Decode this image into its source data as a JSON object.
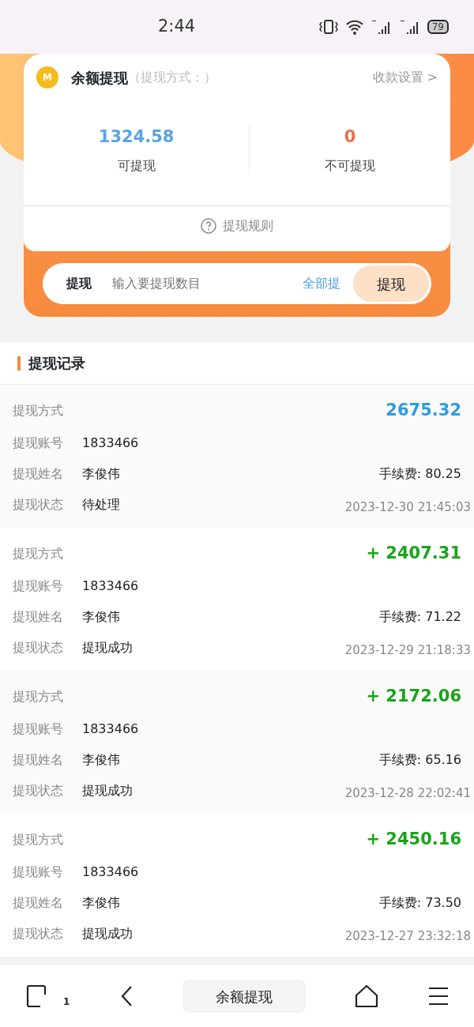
{
  "status_bar": {
    "time": "2:44",
    "battery": "79"
  },
  "balance_card": {
    "coin_letter": "M",
    "title": "余额提现",
    "subtitle": "（提现方式：）",
    "settings_link": "收款设置 >",
    "available": {
      "amount": "1324.58",
      "label": "可提现"
    },
    "unavailable": {
      "amount": "0",
      "label": "不可提现"
    },
    "rules_link": "提现规则"
  },
  "withdraw_bar": {
    "label": "提现",
    "placeholder": "输入要提现数目",
    "all_link": "全部提",
    "submit": "提现"
  },
  "records_title": "提现记录",
  "records": [
    {
      "kind": "pending",
      "method_label": "提现方式",
      "account_label": "提现账号",
      "account": "1833466",
      "name_label": "提现姓名",
      "name": "李俊伟",
      "status_label": "提现状态",
      "status": "待处理",
      "amount": "2675.32",
      "fee": "手续费: 80.25",
      "time": "2023-12-30 21:45:03"
    },
    {
      "kind": "success",
      "method_label": "提现方式",
      "account_label": "提现账号",
      "account": "1833466",
      "name_label": "提现姓名",
      "name": "李俊伟",
      "status_label": "提现状态",
      "status": "提现成功",
      "amount": "+ 2407.31",
      "fee": "手续费: 71.22",
      "time": "2023-12-29 21:18:33"
    },
    {
      "kind": "success",
      "method_label": "提现方式",
      "account_label": "提现账号",
      "account": "1833466",
      "name_label": "提现姓名",
      "name": "李俊伟",
      "status_label": "提现状态",
      "status": "提现成功",
      "amount": "+ 2172.06",
      "fee": "手续费: 65.16",
      "time": "2023-12-28 22:02:41"
    },
    {
      "kind": "success",
      "method_label": "提现方式",
      "account_label": "提现账号",
      "account": "1833466",
      "name_label": "提现姓名",
      "name": "李俊伟",
      "status_label": "提现状态",
      "status": "提现成功",
      "amount": "+ 2450.16",
      "fee": "手续费: 73.50",
      "time": "2023-12-27 23:32:18"
    }
  ],
  "bottom_nav": {
    "tab_count": "1",
    "page_title": "余额提现"
  }
}
